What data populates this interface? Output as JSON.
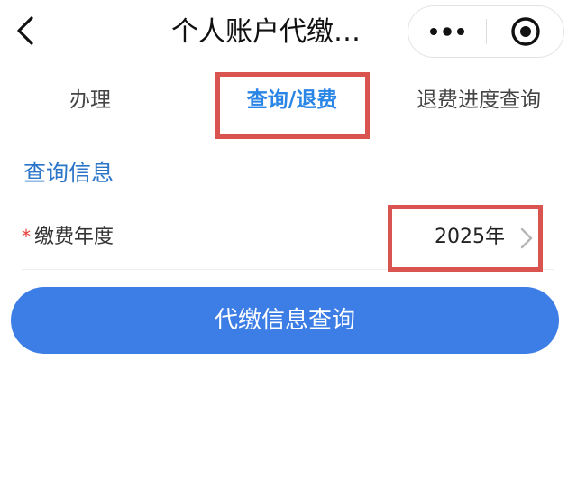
{
  "header": {
    "title": "个人账户代缴…",
    "back_icon": "chevron-left-icon",
    "more_icon": "more-dots-icon",
    "close_icon": "target-close-icon"
  },
  "tabs": [
    {
      "label": "办理",
      "active": false
    },
    {
      "label": "查询/退费",
      "active": true
    },
    {
      "label": "退费进度查询",
      "active": false
    }
  ],
  "section": {
    "title": "查询信息"
  },
  "form": {
    "year": {
      "required_mark": "*",
      "label": "缴费年度",
      "value": "2025年",
      "arrow_icon": "chevron-right-icon"
    }
  },
  "actions": {
    "query_label": "代缴信息查询"
  },
  "colors": {
    "accent": "#2a86e6",
    "button": "#3d7ee6",
    "highlight": "#d9534f",
    "required": "#e53935"
  }
}
